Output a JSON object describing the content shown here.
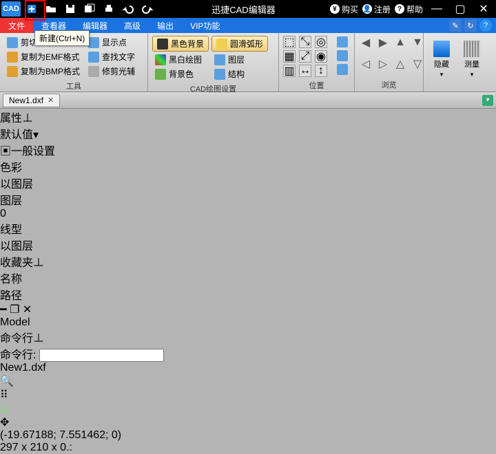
{
  "app": {
    "title": "迅捷CAD编辑器"
  },
  "titlebar_right": {
    "buy": "购买",
    "register": "注册",
    "help": "帮助"
  },
  "tooltip": {
    "new": "新建(Ctrl+N)"
  },
  "menu": {
    "file": "文件",
    "viewer": "查看器",
    "editor": "编辑器",
    "advanced": "高级",
    "output": "输出",
    "vip": "VIP功能"
  },
  "ribbon": {
    "tools": {
      "label": "工具",
      "cut_frame": "剪切框架",
      "copy_emf": "复制为EMF格式",
      "copy_bmp": "复制为BMP格式",
      "show_point": "显示点",
      "find_text": "查找文字",
      "trim_highlight": "修剪光辅"
    },
    "cad": {
      "label": "CAD绘图设置",
      "black_bg": "黑色背景",
      "smooth_arc": "圆滑弧形",
      "bw_draw": "黑白绘图",
      "layer": "图层",
      "bg_color": "背景色",
      "structure": "结构"
    },
    "position": {
      "label": "位置"
    },
    "browse": {
      "label": "浏览"
    },
    "hide": "隐藏",
    "measure": "测量"
  },
  "doc": {
    "tab1": "New1.dxf"
  },
  "props": {
    "title": "属性",
    "default": "默认值",
    "general": "一般设置",
    "row_color": "色彩",
    "row_color_val": "以图层",
    "row_layer": "图层",
    "row_layer_val": "0",
    "row_ltype": "线型",
    "row_ltype_val": "以图层"
  },
  "fav": {
    "title": "收藏夹",
    "col_name": "名称",
    "col_path": "路径"
  },
  "canvas": {
    "model_tab": "Model"
  },
  "cmd": {
    "title": "命令行",
    "prompt": "命令行:"
  },
  "status": {
    "file": "New1.dxf",
    "coords": "(-19.67188; 7.551462; 0)",
    "dims": "297 x 210 x 0.:"
  }
}
